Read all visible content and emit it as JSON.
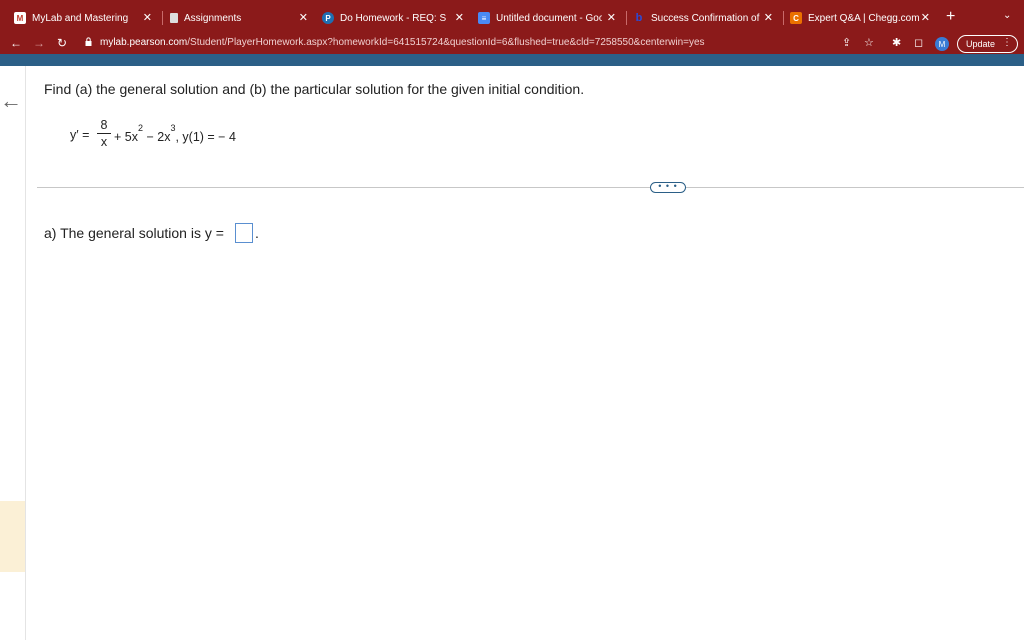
{
  "browser": {
    "tabs": [
      {
        "title": "MyLab and Mastering",
        "icon": "mylab-icon"
      },
      {
        "title": "Assignments",
        "icon": "assignments-icon"
      },
      {
        "title": "Do Homework - REQ: Secti",
        "icon": "pearson-icon",
        "active": true
      },
      {
        "title": "Untitled document - Googl",
        "icon": "google-docs-icon"
      },
      {
        "title": "Success Confirmation of Q",
        "icon": "bartleby-icon"
      },
      {
        "title": "Expert Q&A | Chegg.com",
        "icon": "chegg-icon"
      }
    ],
    "new_tab_label": "+",
    "url_host": "mylab.pearson.com",
    "url_path": "/Student/PlayerHomework.aspx?homeworkId=641515724&questionId=6&flushed=true&cld=7258550&centerwin=yes",
    "avatar_letter": "M",
    "update_label": "Update",
    "colors": {
      "chrome": "#8b1a1a",
      "accent_bar": "#2b5f87"
    }
  },
  "question": {
    "prompt": "Find (a) the general solution and (b) the particular solution for the given initial condition.",
    "equation": {
      "lhs": "y′ =",
      "numerator": "8",
      "denominator": "x",
      "term1": "+ 5x",
      "exp1": "2",
      "term2": " − 2x",
      "exp2": "3",
      "condition": ", y(1) = − 4"
    },
    "more_label": "• • •",
    "part_a_label": "a) The general solution is y =",
    "part_a_value": "",
    "part_a_suffix": "."
  }
}
